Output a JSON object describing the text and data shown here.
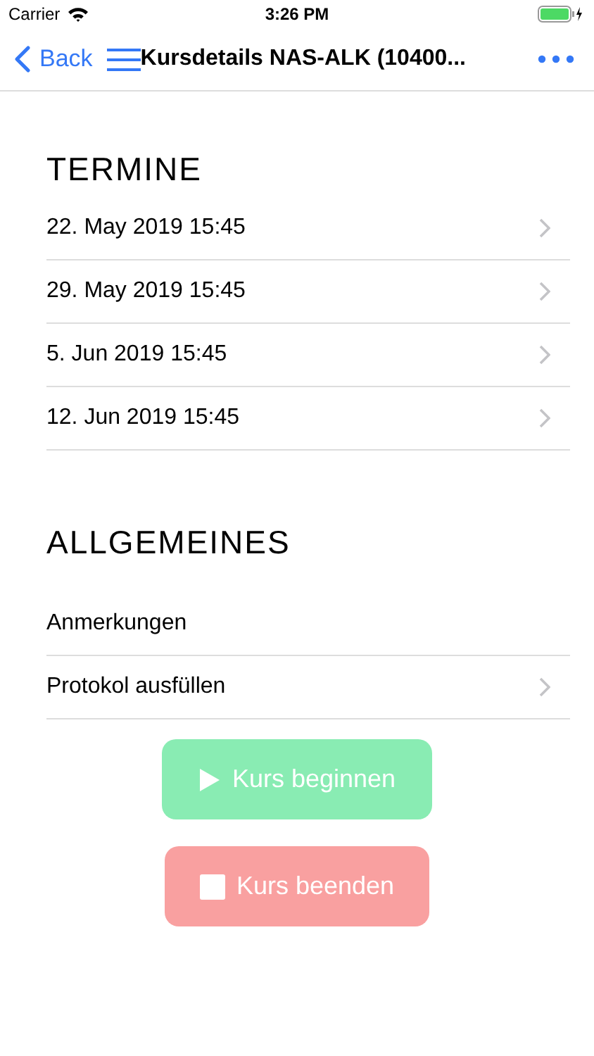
{
  "status_bar": {
    "carrier": "Carrier",
    "time": "3:26 PM"
  },
  "nav": {
    "back": "Back",
    "title": "Kursdetails NAS-ALK (10400..."
  },
  "sections": [
    {
      "title": "TERMINE",
      "rows": [
        {
          "label": "22. May 2019 15:45",
          "chevron": true
        },
        {
          "label": "29. May 2019 15:45",
          "chevron": true
        },
        {
          "label": "5. Jun 2019 15:45",
          "chevron": true
        },
        {
          "label": "12. Jun 2019 15:45",
          "chevron": true
        }
      ]
    },
    {
      "title": "ALLGEMEINES",
      "rows": [
        {
          "label": "Anmerkungen",
          "chevron": false
        },
        {
          "label": "Protokol ausfüllen",
          "chevron": true
        }
      ]
    }
  ],
  "buttons": [
    {
      "kind": "start",
      "label": "Kurs beginnen"
    },
    {
      "kind": "stop",
      "label": "Kurs beenden"
    }
  ]
}
